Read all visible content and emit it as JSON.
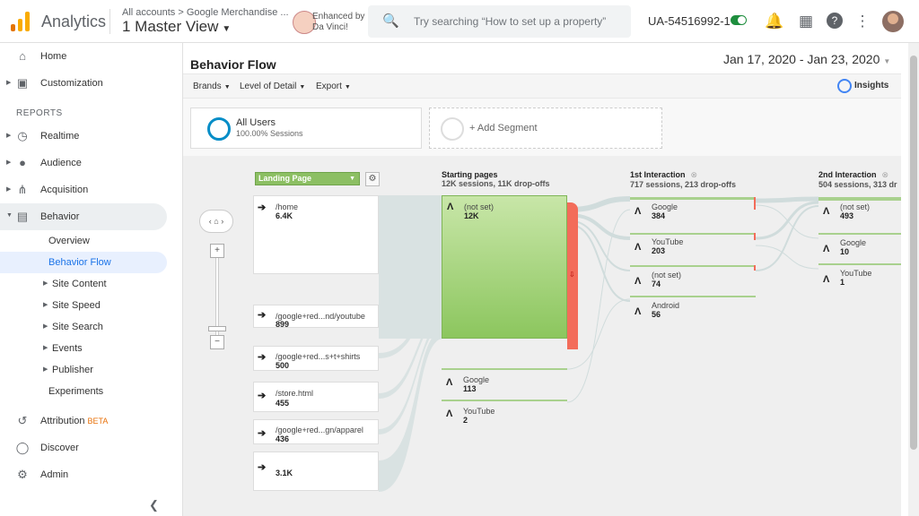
{
  "header": {
    "app_name": "Analytics",
    "account_path": "All accounts > Google Merchandise ...",
    "view_name": "1 Master View",
    "extension_text": "Enhanced by Da Vinci!",
    "search_placeholder": "Try searching “How to set up a property”",
    "property_id": "UA-54516992-1",
    "icons": [
      "bell-icon",
      "apps-icon",
      "help-icon",
      "more-vert-icon",
      "avatar"
    ]
  },
  "sidebar": {
    "top_items": [
      {
        "label": "Home",
        "icon": "home-icon"
      },
      {
        "label": "Customization",
        "icon": "dashboard-icon"
      }
    ],
    "reports_header": "REPORTS",
    "report_items": [
      {
        "label": "Realtime",
        "icon": "clock-icon"
      },
      {
        "label": "Audience",
        "icon": "person-icon"
      },
      {
        "label": "Acquisition",
        "icon": "acquisition-icon"
      },
      {
        "label": "Behavior",
        "icon": "behavior-icon",
        "active": true
      }
    ],
    "behavior_sub": [
      {
        "label": "Overview"
      },
      {
        "label": "Behavior Flow",
        "active": true
      },
      {
        "label": "Site Content"
      },
      {
        "label": "Site Speed"
      },
      {
        "label": "Site Search"
      },
      {
        "label": "Events"
      },
      {
        "label": "Publisher"
      },
      {
        "label": "Experiments"
      }
    ],
    "bottom_items": [
      {
        "label": "Attribution",
        "badge": "BETA",
        "icon": "attribution-icon"
      },
      {
        "label": "Discover",
        "icon": "lightbulb-icon"
      },
      {
        "label": "Admin",
        "icon": "gear-icon"
      }
    ]
  },
  "main": {
    "title": "Behavior Flow",
    "date_range": "Jan 17, 2020 - Jan 23, 2020",
    "toolbar": {
      "brands": "Brands",
      "level_of_detail": "Level of Detail",
      "export": "Export",
      "insights": "Insights"
    },
    "segment": {
      "name": "All Users",
      "sessions": "100.00% Sessions",
      "add": "+ Add Segment"
    },
    "dimension": "Landing Page",
    "columns": [
      {
        "title": "Starting pages",
        "stats": "12K sessions, 11K drop-offs"
      },
      {
        "title": "1st Interaction",
        "stats": "717 sessions, 213 drop-offs"
      },
      {
        "title": "2nd Interaction",
        "stats": "504 sessions, 313 dr"
      }
    ],
    "landing_pages": [
      {
        "name": "/home",
        "value": "6.4K"
      },
      {
        "name": "/google+red...nd/youtube",
        "value": "899"
      },
      {
        "name": "/google+red...s+t+shirts",
        "value": "500"
      },
      {
        "name": "/store.html",
        "value": "455"
      },
      {
        "name": "/google+red...gn/apparel",
        "value": "436"
      },
      {
        "name": "",
        "value": "3.1K"
      }
    ],
    "starting_pages": [
      {
        "name": "(not set)",
        "value": "12K"
      },
      {
        "name": "Google",
        "value": "113"
      },
      {
        "name": "YouTube",
        "value": "2"
      }
    ],
    "first_interaction": [
      {
        "name": "Google",
        "value": "384"
      },
      {
        "name": "YouTube",
        "value": "203"
      },
      {
        "name": "(not set)",
        "value": "74"
      },
      {
        "name": "Android",
        "value": "56"
      }
    ],
    "second_interaction": [
      {
        "name": "(not set)",
        "value": "493"
      },
      {
        "name": "Google",
        "value": "10"
      },
      {
        "name": "YouTube",
        "value": "1"
      }
    ]
  }
}
